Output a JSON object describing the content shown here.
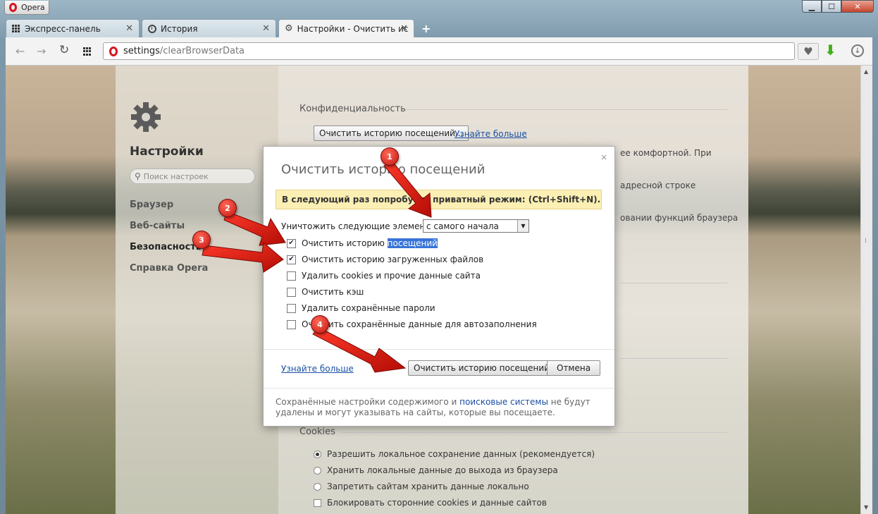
{
  "window": {
    "app_button": "Opera",
    "controls": {
      "minimize": "▁",
      "maximize": "☐",
      "close": "✕"
    }
  },
  "tabs": [
    {
      "label": "Экспресс-панель",
      "icon": "grid-icon"
    },
    {
      "label": "История",
      "icon": "clock-icon"
    },
    {
      "label": "Настройки - Очистить ис",
      "icon": "gear-icon",
      "active": true
    }
  ],
  "new_tab": "+",
  "toolbar": {
    "address_host": "settings",
    "address_path": "/clearBrowserData"
  },
  "sidebar": {
    "title": "Настройки",
    "search_placeholder": "Поиск настроек",
    "items": [
      {
        "label": "Браузер"
      },
      {
        "label": "Веб-сайты"
      },
      {
        "label": "Безопасность",
        "active": true
      },
      {
        "label": "Справка Opera"
      }
    ]
  },
  "main": {
    "privacy_title": "Конфиденциальность",
    "clear_history_btn": "Очистить историю посещений...",
    "learn_more": "Узнайте больше",
    "bg_line1": "ее комфортной. При",
    "bg_line2": "адресной строке",
    "bg_line3": "овании функций браузера",
    "cookies_title": "Cookies",
    "cookie_options": [
      {
        "label": "Разрешить локальное сохранение данных (рекомендуется)",
        "selected": true
      },
      {
        "label": "Хранить локальные данные до выхода из браузера",
        "selected": false
      },
      {
        "label": "Запретить сайтам хранить данные локально",
        "selected": false
      }
    ],
    "block_third_party": "Блокировать сторонние cookies и данные сайтов"
  },
  "dialog": {
    "title": "Очистить историю посещений",
    "close": "×",
    "tip": "В следующий раз попробуйте приватный режим: (Ctrl+Shift+N).",
    "destroy_label": "Уничтожить следующие элементы:",
    "period_selected": "с самого начала",
    "items": [
      {
        "prefix": "Очистить историю ",
        "highlight": "посещений",
        "checked": true
      },
      {
        "prefix": "Очистить историю загруженных файлов",
        "highlight": "",
        "checked": true
      },
      {
        "prefix": "Удалить cookies и прочие данные сайта",
        "highlight": "",
        "checked": false
      },
      {
        "prefix": "Очистить кэш",
        "highlight": "",
        "checked": false
      },
      {
        "prefix": "Удалить сохранённые пароли",
        "highlight": "",
        "checked": false
      },
      {
        "prefix": "Очистить сохранённые данные для автозаполнения",
        "highlight": "",
        "checked": false
      }
    ],
    "learn_more": "Узнайте больше",
    "confirm_btn": "Очистить историю посещений",
    "cancel_btn": "Отмена",
    "note_before": "Сохранённые настройки содержимого и ",
    "note_link": "поисковые системы",
    "note_after": " не будут удалены и могут указывать на сайты, которые вы посещаете."
  },
  "annotations": [
    "1",
    "2",
    "3",
    "4"
  ],
  "colors": {
    "arrow": "#e0190f",
    "opera_red": "#d6161f",
    "tip_bg": "#fbefb4",
    "selection": "#3874d8"
  }
}
